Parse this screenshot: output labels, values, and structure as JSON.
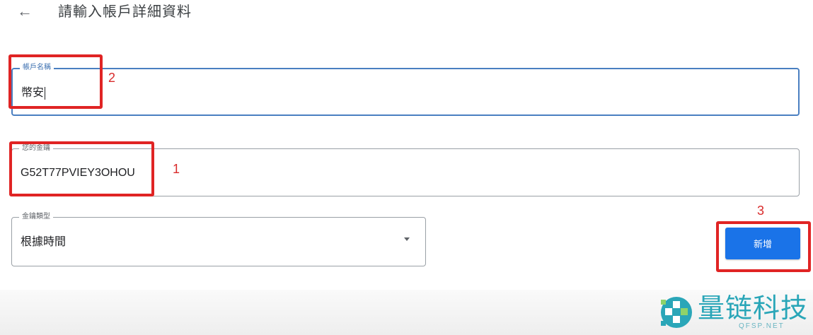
{
  "header": {
    "back_icon": "arrow-left-icon",
    "back_glyph": "←",
    "title": "請輸入帳戶詳細資料"
  },
  "form": {
    "account_name": {
      "label": "帳戶名稱",
      "value": "幣安"
    },
    "key": {
      "label": "您的金鑰",
      "value": "G52T77PVIEY3OHOU"
    },
    "key_type": {
      "label": "金鑰類型",
      "selected": "根據時間"
    },
    "add_button": {
      "label": "新增"
    }
  },
  "annotations": {
    "one": "1",
    "two": "2",
    "three": "3"
  },
  "watermark": {
    "name": "量链科技",
    "sub": "QFSP.NET"
  },
  "colors": {
    "accent": "#1a73e8",
    "focus_border": "#4a7fc1",
    "annotation_red": "#e02424",
    "logo_teal": "#2aa6b8"
  }
}
